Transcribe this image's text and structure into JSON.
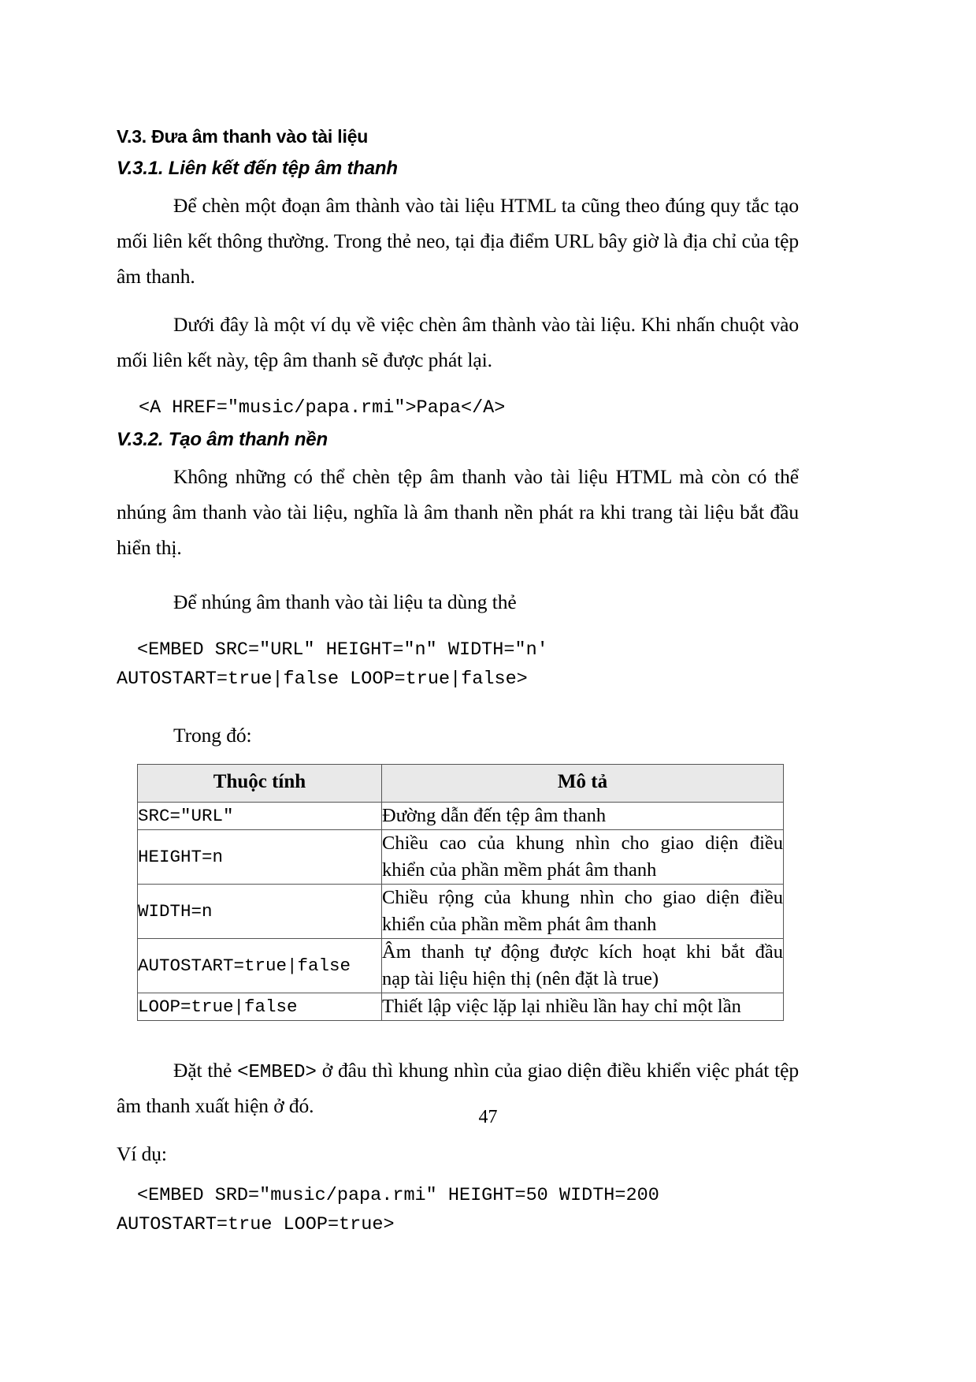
{
  "document": {
    "page_number": "47",
    "headings": {
      "section": "V.3. Đưa âm thanh vào tài liệu",
      "sub1": "V.3.1. Liên kết đến tệp âm thanh",
      "sub2": "V.3.2. Tạo âm thanh nền"
    },
    "paragraphs": {
      "p1": "Để chèn một đoạn âm thành vào tài liệu HTML ta cũng theo đúng quy tắc tạo mối liên kết thông thường. Trong thẻ neo, tại địa điểm URL bây giờ là địa chỉ của tệp âm thanh.",
      "p2": "Dưới đây là một ví dụ về việc chèn âm thành vào tài liệu. Khi nhấn chuột vào mối liên kết này, tệp âm thanh sẽ được phát lại.",
      "p3": "Không những có thể chèn tệp âm thanh vào tài liệu HTML mà còn có thể nhúng âm thanh vào tài liệu, nghĩa là âm thanh nền phát ra khi trang tài liệu bắt đầu hiển thị.",
      "p4": "Để nhúng âm thanh vào tài liệu ta dùng thẻ",
      "p5_intro": "Trong đó:",
      "p6_prefix": "Đặt thẻ ",
      "p6_code": "<EMBED>",
      "p6_suffix": " ở đâu thì khung nhìn của giao diện điều khiển việc phát tệp âm thanh xuất hiện ở đó.",
      "p7": "Ví dụ:"
    },
    "code_blocks": {
      "anchor_example": "<A HREF=″music/papa.rmi″>Papa</A>",
      "embed_syntax_line1": "<EMBED SRC=″URL″ HEIGHT=″n″ WIDTH=″n′",
      "embed_syntax_line2": "AUTOSTART=true|false LOOP=true|false>",
      "embed_example_line1": "<EMBED SRD=″music/papa.rmi″ HEIGHT=50 WIDTH=200",
      "embed_example_line2": "AUTOSTART=true LOOP=true>"
    },
    "table": {
      "headers": [
        "Thuộc tính",
        "Mô tả"
      ],
      "rows": [
        {
          "attribute": "SRC=″URL″",
          "description_line1": "Đường dẫn đến tệp âm thanh",
          "description_line2": ""
        },
        {
          "attribute": "HEIGHT=n",
          "description_line1": "Chiều cao của khung nhìn cho giao diện điều",
          "description_line2": "khiển của phần mềm phát âm thanh"
        },
        {
          "attribute": "WIDTH=n",
          "description_line1": "Chiều rộng của khung nhìn cho giao diện điều",
          "description_line2": "khiển của phần mềm phát âm thanh"
        },
        {
          "attribute": "AUTOSTART=true|false",
          "description_line1": "Âm thanh tự động được kích hoạt khi bắt đầu",
          "description_line2": "nạp tài liệu hiện thị (nên đặt là true)"
        },
        {
          "attribute": "LOOP=true|false",
          "description_line1": "Thiết lập việc lặp lại nhiều lần hay chỉ một lần",
          "description_line2": ""
        }
      ],
      "header_background": "#e9e9e9",
      "border_color": "#555555"
    }
  }
}
